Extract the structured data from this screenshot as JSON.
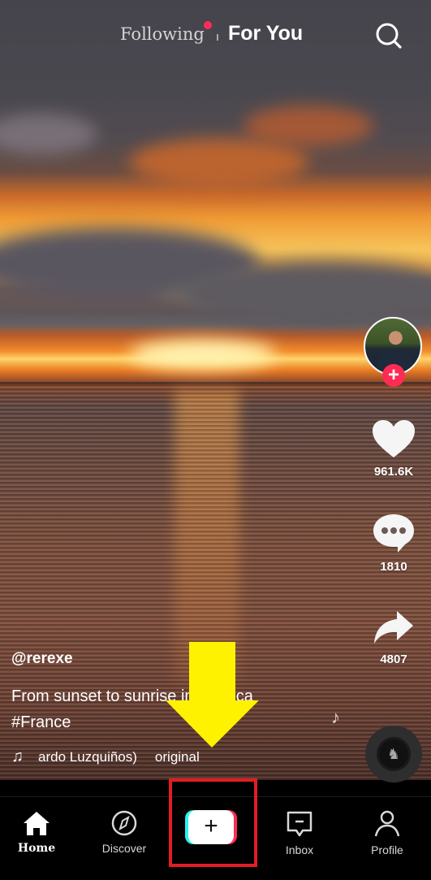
{
  "top_tabs": {
    "following_label": "Following",
    "for_you_label": "For You",
    "active_tab": "For You",
    "following_has_new": true
  },
  "icons": {
    "search": "search-icon",
    "like": "heart-icon",
    "comment": "comment-bubble-icon",
    "share": "share-arrow-icon",
    "follow": "plus-icon",
    "sound": "music-note-icon",
    "home": "home-icon",
    "discover": "compass-icon",
    "create": "plus-icon",
    "inbox": "inbox-message-icon",
    "profile": "person-icon"
  },
  "actions": {
    "follow_symbol": "+",
    "like_count": "961.6K",
    "comment_count": "1810",
    "share_count": "4807"
  },
  "post": {
    "username": "@rerexe",
    "caption_line1": "From sunset to sunrise in Corsica",
    "caption_line2": "#France",
    "sound_text": "ardo Luzquiños)",
    "sound_original": "original",
    "sound_note_glyph": "♫"
  },
  "nav": {
    "items": [
      {
        "label": "Home",
        "active": true
      },
      {
        "label": "Discover",
        "active": false
      },
      {
        "label": "",
        "active": false
      },
      {
        "label": "Inbox",
        "active": false
      },
      {
        "label": "Profile",
        "active": false
      }
    ],
    "create_symbol": "+"
  },
  "colors": {
    "accent_red": "#fe2c55",
    "create_cyan": "#25f4ee",
    "annotation_arrow": "#fff200",
    "annotation_box": "#e11d24"
  }
}
